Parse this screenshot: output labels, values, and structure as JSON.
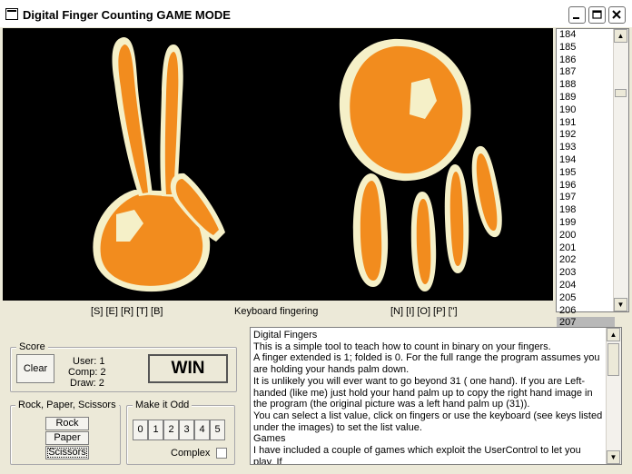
{
  "window": {
    "title": "Digital Finger Counting  GAME MODE"
  },
  "display": {
    "binary_value": "0011001111",
    "keys_left": "[S] [E] [R] [T] [B]",
    "keyboard_label": "Keyboard fingering",
    "keys_right": "[N] [I] [O] [P] [\"]"
  },
  "number_list": {
    "items": [
      "184",
      "185",
      "186",
      "187",
      "188",
      "189",
      "190",
      "191",
      "192",
      "193",
      "194",
      "195",
      "196",
      "197",
      "198",
      "199",
      "200",
      "201",
      "202",
      "203",
      "204",
      "205",
      "206",
      "207"
    ],
    "selected": "207"
  },
  "score": {
    "title": "Score",
    "clear_label": "Clear",
    "user": "User: 1",
    "comp": "Comp: 2",
    "draw": "Draw: 2",
    "result": "WIN"
  },
  "rps": {
    "title": "Rock, Paper, Scissors",
    "buttons": [
      "Rock",
      "Paper",
      "Scissors"
    ]
  },
  "odd": {
    "title": "Make it Odd",
    "buttons": [
      "0",
      "1",
      "2",
      "3",
      "4",
      "5"
    ],
    "complex_label": "Complex"
  },
  "help_text": "Digital Fingers\nThis is a simple tool to teach how to count in binary on your fingers.\nA finger extended is 1; folded is 0. For the full range the program assumes you are holding your hands palm down.\nIt is unlikely you will ever want to go beyond 31 ( one hand). If you are Left-handed (like me) just hold your hand palm up to copy the right hand image in the program (the original picture was a left hand palm up (31)).\nYou can select a list value, click on fingers or use the keyboard (see keys listed under the images) to set the list value.\nGames\nI have included a couple of games which exploit the UserControl to let you play. If",
  "colors": {
    "hand_orange": "#f28c1e",
    "binary_green": "#39e339"
  }
}
